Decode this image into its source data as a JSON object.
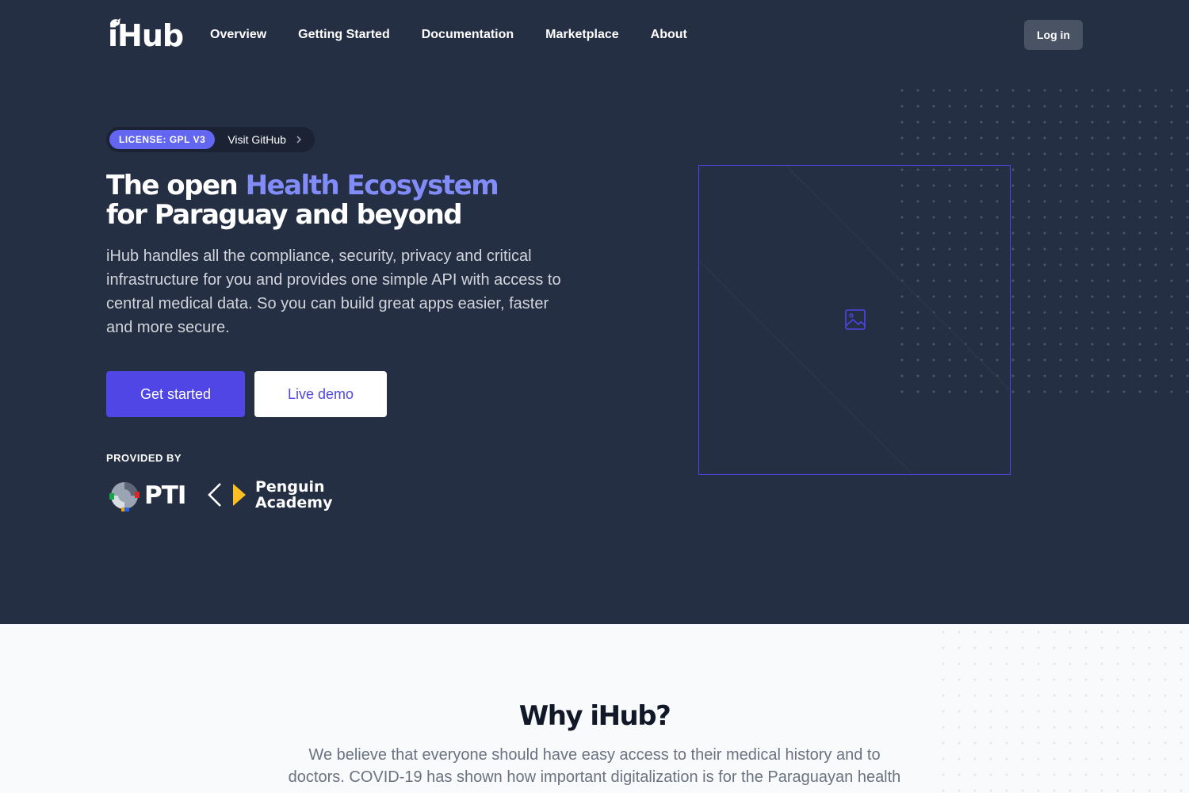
{
  "brand": {
    "name": "iHub"
  },
  "nav": {
    "links": [
      "Overview",
      "Getting Started",
      "Documentation",
      "Marketplace",
      "About"
    ],
    "login_label": "Log in"
  },
  "hero": {
    "badge": "LICENSE: GPL V3",
    "badge_link": "Visit GitHub",
    "title_part1": "The open ",
    "title_accent": "Health Ecosystem",
    "title_line2": "for Paraguay and beyond",
    "lead": "iHub handles all the compliance, security, privacy and critical infrastructure for you and provides one simple API with access to central medical data. So you can build great apps easier, faster and more secure.",
    "primary_cta": "Get started",
    "secondary_cta": "Live demo",
    "provided_by": "PROVIDED BY",
    "providers": [
      {
        "name": "PTI",
        "icon": "pti-logo"
      },
      {
        "name_line1": "Penguin",
        "name_line2": "Academy",
        "icon": "penguin-academy-logo"
      }
    ],
    "image_placeholder_icon": "image-icon"
  },
  "why": {
    "title": "Why iHub?",
    "text": "We believe that everyone should have easy access to their medical history and to doctors. COVID-19 has shown how important digitalization is for the Paraguayan health"
  },
  "colors": {
    "hero_bg": "#252f43",
    "accent": "#818cf8",
    "primary": "#4f46e5",
    "badge": "#6366f1"
  }
}
